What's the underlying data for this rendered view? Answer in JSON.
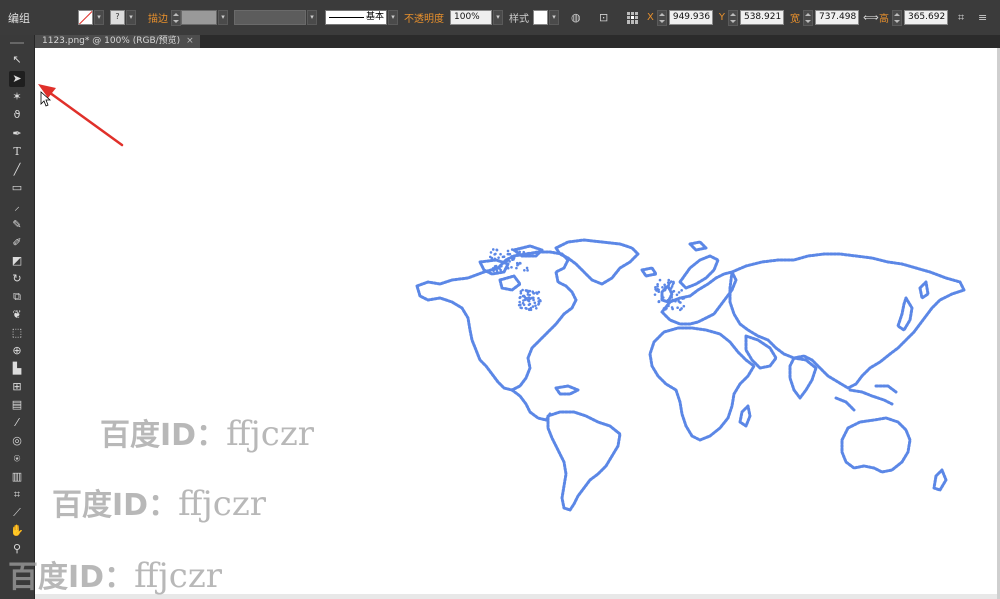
{
  "control_bar": {
    "selection_label": "编组",
    "stroke_label": "描边",
    "stroke_style_label": "基本",
    "opacity_label": "不透明度",
    "opacity_value": "100%",
    "style_label": "样式",
    "x_label": "X",
    "x_value": "949.936",
    "y_label": "Y",
    "y_value": "538.921",
    "width_label": "宽",
    "width_value": "737.498",
    "height_label": "高",
    "height_value": "365.692"
  },
  "document": {
    "tab_title": "1123.png* @ 100% (RGB/预览)",
    "tab_close": "×"
  },
  "tools": [
    "selection-tool",
    "direct-selection-tool",
    "magic-wand-tool",
    "lasso-tool",
    "pen-tool",
    "type-tool",
    "line-tool",
    "rectangle-tool",
    "paintbrush-tool",
    "pencil-tool",
    "blob-brush-tool",
    "eraser-tool",
    "rotate-tool",
    "scale-tool",
    "warp-tool",
    "free-transform-tool",
    "shape-builder-tool",
    "perspective-grid-tool",
    "mesh-tool",
    "gradient-tool",
    "eyedropper-tool",
    "blend-tool",
    "symbol-sprayer-tool",
    "column-graph-tool",
    "artboard-tool",
    "slice-tool",
    "hand-tool",
    "zoom-tool"
  ],
  "watermarks": [
    {
      "cn": "百度ID：",
      "en": "ffjczr"
    },
    {
      "cn": "百度ID：",
      "en": "ffjczr"
    },
    {
      "cn": "百度ID：",
      "en": "ffjczr"
    }
  ],
  "colors": {
    "map_fill": "#5b87e6",
    "arrow": "#e0302a",
    "ui_orange": "#e8902c"
  }
}
